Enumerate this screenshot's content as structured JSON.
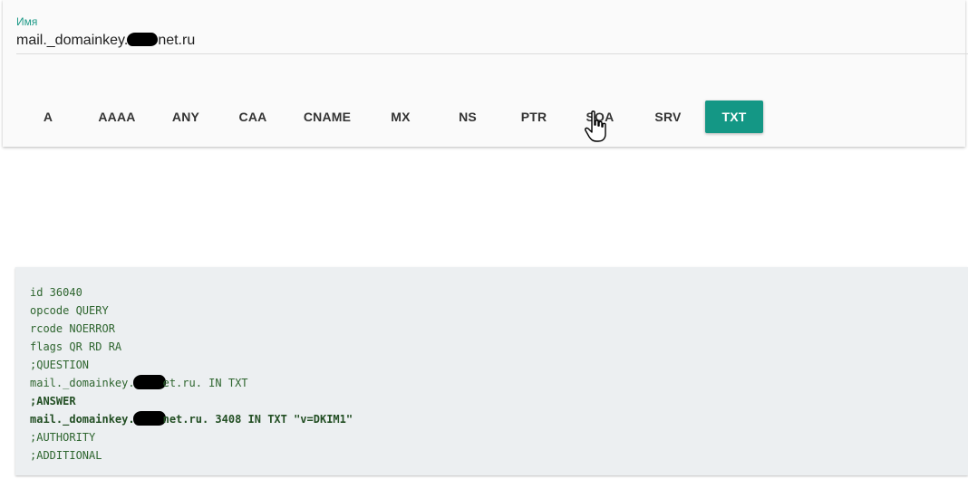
{
  "query_form": {
    "name_label": "Имя",
    "name_value_prefix": "mail._domainkey.",
    "name_value_suffix": "net.ru",
    "record_types": [
      {
        "label": "A",
        "active": false
      },
      {
        "label": "AAAA",
        "active": false
      },
      {
        "label": "ANY",
        "active": false
      },
      {
        "label": "CAA",
        "active": false
      },
      {
        "label": "CNAME",
        "active": false
      },
      {
        "label": "MX",
        "active": false
      },
      {
        "label": "NS",
        "active": false
      },
      {
        "label": "PTR",
        "active": false
      },
      {
        "label": "SOA",
        "active": false
      },
      {
        "label": "SRV",
        "active": false
      },
      {
        "label": "TXT",
        "active": true
      }
    ]
  },
  "colors": {
    "accent": "#149785",
    "label": "#1f9a88",
    "result_background": "#eceff1",
    "result_text": "#2f6630"
  },
  "result": {
    "lines": [
      {
        "text": "id 36040",
        "bold": false
      },
      {
        "text": "opcode QUERY",
        "bold": false
      },
      {
        "text": "rcode NOERROR",
        "bold": false
      },
      {
        "text": "flags QR RD RA",
        "bold": false
      },
      {
        "text": ";QUESTION",
        "bold": false
      },
      {
        "prefix": "mail._domainkey.",
        "suffix": "et.ru. IN TXT",
        "redacted": true,
        "bold": false
      },
      {
        "text": ";ANSWER",
        "bold": true
      },
      {
        "prefix": "mail._domainkey.",
        "suffix": "net.ru. 3408 IN TXT \"v=DKIM1\"",
        "redacted": true,
        "bold": true
      },
      {
        "text": ";AUTHORITY",
        "bold": false
      },
      {
        "text": ";ADDITIONAL",
        "bold": false
      }
    ]
  }
}
